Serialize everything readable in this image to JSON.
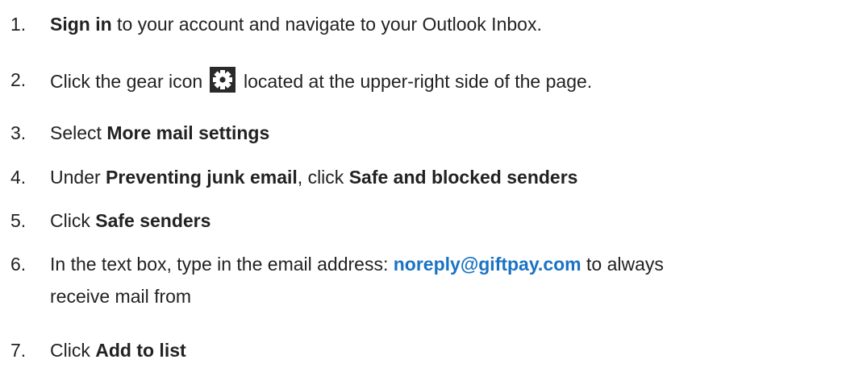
{
  "steps": [
    {
      "number": "1.",
      "parts": {
        "bold": "Sign in",
        "text": " to your account and navigate to your Outlook Inbox."
      }
    },
    {
      "number": "2.",
      "parts": {
        "text_before_icon": "Click the gear icon ",
        "icon": "gear-icon",
        "text_after_icon": " located at the upper-right side of the page."
      }
    },
    {
      "number": "3.",
      "parts": {
        "text": "Select ",
        "bold": "More mail settings"
      }
    },
    {
      "number": "4.",
      "parts": {
        "text1": "Under ",
        "bold1": "Preventing junk email",
        "text2": ", click ",
        "bold2": "Safe and blocked senders"
      }
    },
    {
      "number": "5.",
      "parts": {
        "text": "Click ",
        "bold": "Safe senders"
      }
    },
    {
      "number": "6.",
      "parts": {
        "text1": "In the text box, type in the email address: ",
        "email": "noreply@giftpay.com",
        "text2": " to always",
        "line2": "receive mail from"
      }
    },
    {
      "number": "7.",
      "parts": {
        "text": "Click ",
        "bold": "Add to list"
      }
    }
  ],
  "colors": {
    "text": "#222222",
    "link": "#1a73c4",
    "icon_bg": "#2a2a2a"
  }
}
